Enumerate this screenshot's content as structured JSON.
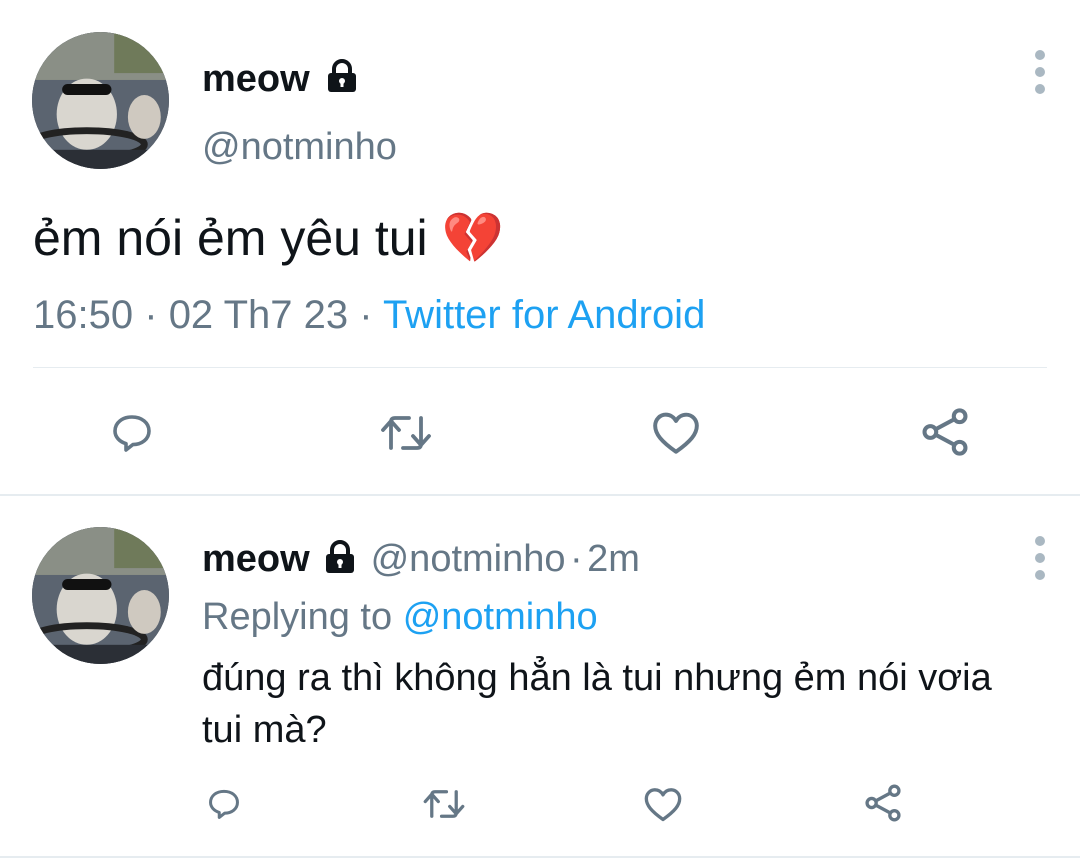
{
  "main_tweet": {
    "display_name": "meow",
    "handle": "@notminho",
    "text": "ẻm nói ẻm yêu tui",
    "emoji": "💔",
    "time": "16:50",
    "date": "02 Th7 23",
    "separator": "·",
    "source": "Twitter for Android"
  },
  "reply_tweet": {
    "display_name": "meow",
    "handle": "@notminho",
    "separator": "·",
    "age": "2m",
    "replying_prefix": "Replying to",
    "replying_to": "@notminho",
    "text": "đúng ra thì không hẳn là tui nhưng ẻm nói vơia tui mà?"
  },
  "colors": {
    "text": "#0f1419",
    "secondary": "#657786",
    "link": "#1da1f2",
    "icon": "#657786",
    "divider": "#e6ecf0"
  },
  "icons": [
    "lock-icon",
    "more-icon",
    "reply-icon",
    "retweet-icon",
    "like-icon",
    "share-icon"
  ]
}
